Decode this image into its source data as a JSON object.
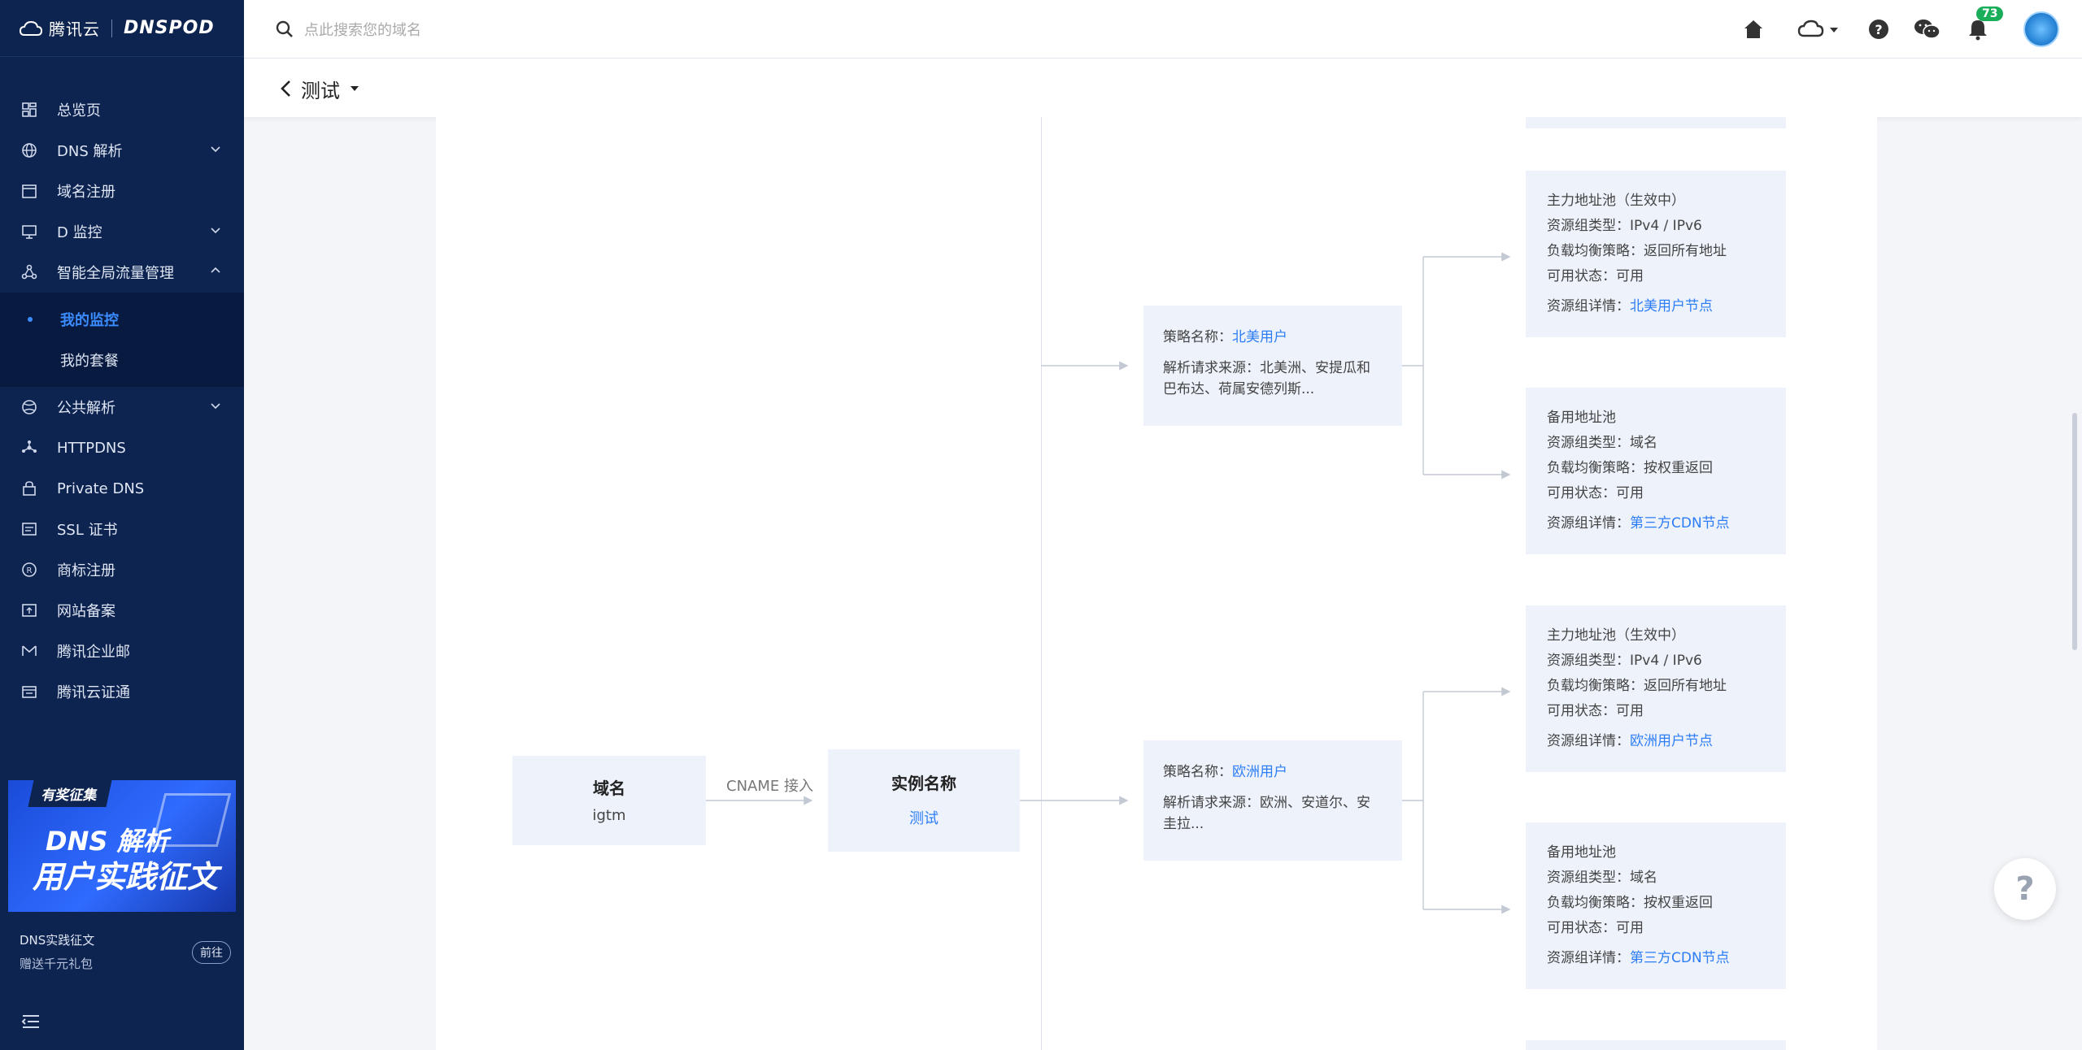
{
  "brand": {
    "name": "腾讯云",
    "product": "DNSPOD"
  },
  "search": {
    "placeholder": "点此搜索您的域名"
  },
  "topbar": {
    "notifications": "73"
  },
  "sidebar": {
    "items": [
      {
        "label": "总览页",
        "icon": "grid-icon"
      },
      {
        "label": "DNS 解析",
        "icon": "globe-icon"
      },
      {
        "label": "域名注册",
        "icon": "calendar-icon"
      },
      {
        "label": "D 监控",
        "icon": "monitor-icon"
      },
      {
        "label": "智能全局流量管理",
        "icon": "nodes-icon"
      }
    ],
    "submenu": [
      {
        "label": "我的监控",
        "active": true
      },
      {
        "label": "我的套餐",
        "active": false
      }
    ],
    "items2": [
      {
        "label": "公共解析",
        "icon": "globe-icon"
      },
      {
        "label": "HTTPDNS",
        "icon": "share-icon"
      },
      {
        "label": "Private DNS",
        "icon": "lock-icon"
      },
      {
        "label": "SSL 证书",
        "icon": "certificate-icon"
      },
      {
        "label": "商标注册",
        "icon": "trademark-icon"
      },
      {
        "label": "网站备案",
        "icon": "record-icon"
      },
      {
        "label": "腾讯企业邮",
        "icon": "mail-icon"
      },
      {
        "label": "腾讯云证通",
        "icon": "id-card-icon"
      }
    ],
    "promo": {
      "badge": "有奖征集",
      "line1": "DNS 解析",
      "line2": "用户实践征文",
      "foot_title": "DNS实践征文",
      "foot_sub": "赠送千元礼包",
      "button": "前往"
    }
  },
  "subheader": {
    "title": "测试"
  },
  "flow": {
    "domain": {
      "title": "域名",
      "value": "igtm"
    },
    "cname_label": "CNAME 接入",
    "instance": {
      "title": "实例名称",
      "value": "测试"
    },
    "strategies": [
      {
        "label": "策略名称：",
        "name": "北美用户",
        "source_label": "解析请求来源：",
        "source": "北美洲、安提瓜和巴布达、荷属安德列斯..."
      },
      {
        "label": "策略名称：",
        "name": "欧洲用户",
        "source_label": "解析请求来源：",
        "source": "欧洲、安道尔、安圭拉..."
      }
    ],
    "pools": [
      {
        "title": "主力地址池（生效中）",
        "type": "资源组类型：IPv4 / IPv6",
        "policy": "负载均衡策略：返回所有地址",
        "status": "可用状态：可用",
        "detail_label": "资源组详情：",
        "detail": "北美用户节点"
      },
      {
        "title": "备用地址池",
        "type": "资源组类型：域名",
        "policy": "负载均衡策略：按权重返回",
        "status": "可用状态：可用",
        "detail_label": "资源组详情：",
        "detail": "第三方CDN节点"
      },
      {
        "title": "主力地址池（生效中）",
        "type": "资源组类型：IPv4 / IPv6",
        "policy": "负载均衡策略：返回所有地址",
        "status": "可用状态：可用",
        "detail_label": "资源组详情：",
        "detail": "欧洲用户节点"
      },
      {
        "title": "备用地址池",
        "type": "资源组类型：域名",
        "policy": "负载均衡策略：按权重返回",
        "status": "可用状态：可用",
        "detail_label": "资源组详情：",
        "detail": "第三方CDN节点"
      }
    ]
  },
  "help": {
    "label": "?"
  }
}
